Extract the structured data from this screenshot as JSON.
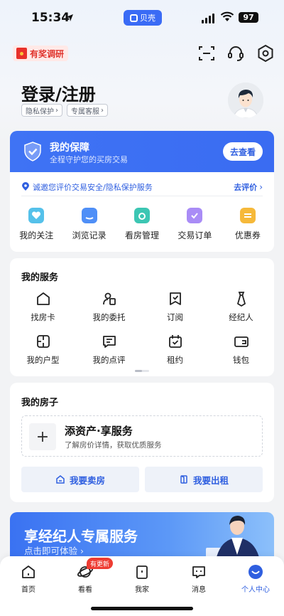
{
  "status": {
    "time": "15:34",
    "app": "贝壳",
    "battery": "97"
  },
  "header": {
    "survey_label": "有奖调研"
  },
  "profile": {
    "title": "登录/注册",
    "tags": [
      "隐私保护",
      "专属客服"
    ]
  },
  "guarantee": {
    "title": "我的保障",
    "subtitle": "全程守护您的买房交易",
    "button": "去查看",
    "eval_text": "诚邀您评价交易安全/隐私保护服务",
    "eval_link": "去评价"
  },
  "quick": [
    {
      "label": "我的关注",
      "icon": "heart-icon",
      "color": "#55c1ea"
    },
    {
      "label": "浏览记录",
      "icon": "history-icon",
      "color": "#4f8ff7"
    },
    {
      "label": "看房管理",
      "icon": "house-view-icon",
      "color": "#3cc6b3"
    },
    {
      "label": "交易订单",
      "icon": "order-icon",
      "color": "#a98cf6"
    },
    {
      "label": "优惠券",
      "icon": "coupon-icon",
      "color": "#f6b93a"
    }
  ],
  "services": {
    "title": "我的服务",
    "items": [
      {
        "label": "找房卡",
        "icon": "house-card-icon"
      },
      {
        "label": "我的委托",
        "icon": "entrust-icon"
      },
      {
        "label": "订阅",
        "icon": "subscribe-icon"
      },
      {
        "label": "经纪人",
        "icon": "agent-icon"
      },
      {
        "label": "我的户型",
        "icon": "floorplan-icon"
      },
      {
        "label": "我的点评",
        "icon": "review-icon"
      },
      {
        "label": "租约",
        "icon": "lease-icon"
      },
      {
        "label": "钱包",
        "icon": "wallet-icon"
      }
    ]
  },
  "my_house": {
    "title": "我的房子",
    "add_title": "添资产·享服务",
    "add_sub": "了解房价详情，获取优质服务",
    "sell_label": "我要卖房",
    "rent_label": "我要出租"
  },
  "banner": {
    "title": "享经纪人专属服务",
    "subtitle": "点击即可体验"
  },
  "tabs": [
    {
      "label": "首页",
      "icon": "home-icon"
    },
    {
      "label": "看看",
      "icon": "planet-icon"
    },
    {
      "label": "我家",
      "icon": "my-home-icon"
    },
    {
      "label": "消息",
      "icon": "message-icon"
    },
    {
      "label": "个人中心",
      "icon": "profile-icon"
    }
  ],
  "tab_badge": "有更新",
  "colors": {
    "accent": "#2f5fe0",
    "guard_bg": "#3f73f4"
  }
}
